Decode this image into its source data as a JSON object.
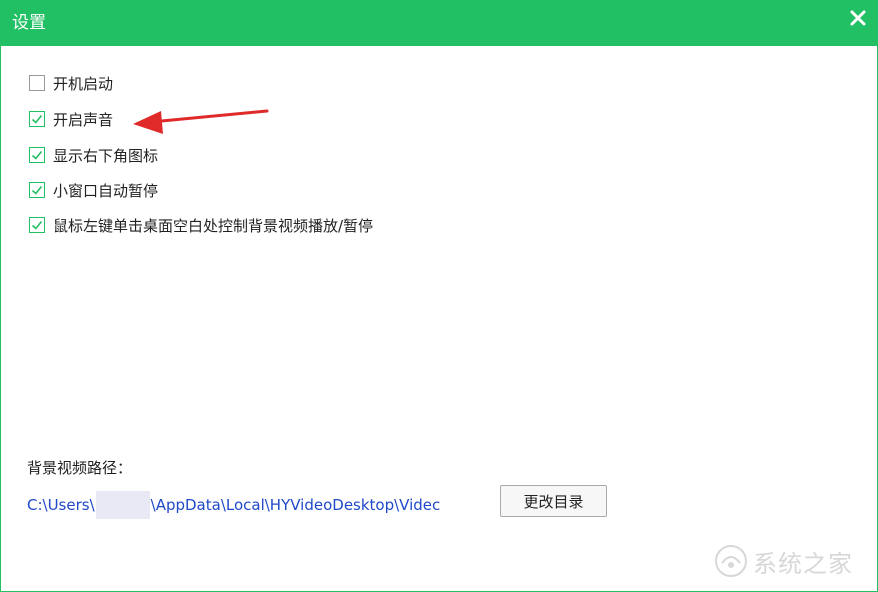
{
  "window": {
    "title": "设置",
    "accent_color": "#22c064"
  },
  "options": [
    {
      "label": "开机启动",
      "checked": false
    },
    {
      "label": "开启声音",
      "checked": true
    },
    {
      "label": "显示右下角图标",
      "checked": true
    },
    {
      "label": "小窗口自动暂停",
      "checked": true
    },
    {
      "label": "鼠标左键单击桌面空白处控制背景视频播放/暂停",
      "checked": true
    }
  ],
  "annotation": {
    "color": "#e02a2a",
    "icon": "red-arrow"
  },
  "video_path": {
    "label": "背景视频路径：",
    "prefix": "C:\\Users\\",
    "suffix": "\\AppData\\Local\\HYVideoDesktop\\Videc",
    "link_color": "#1f49c8"
  },
  "change_dir_button": "更改目录",
  "watermark": "系统之家"
}
